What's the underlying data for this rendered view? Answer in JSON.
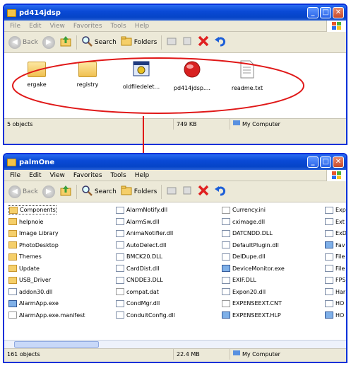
{
  "top_window": {
    "title": "pd414jdsp",
    "menu": [
      "File",
      "Edit",
      "View",
      "Favorites",
      "Tools",
      "Help"
    ],
    "toolbar": {
      "back": "Back",
      "search": "Search",
      "folders": "Folders"
    },
    "icons": [
      {
        "label": "ergake",
        "icon": "folder-icon"
      },
      {
        "label": "registry",
        "icon": "folder-icon"
      },
      {
        "label": "oldfiledelet...",
        "icon": "application-icon"
      },
      {
        "label": "pd414jdsp....",
        "icon": "red-ball-icon"
      },
      {
        "label": "readme.txt",
        "icon": "text-file-icon"
      }
    ],
    "status": {
      "objects": "5 objects",
      "size": "749 KB",
      "location": "My Computer"
    }
  },
  "bottom_window": {
    "title": "palmOne",
    "menu": [
      "File",
      "Edit",
      "View",
      "Favorites",
      "Tools",
      "Help"
    ],
    "toolbar": {
      "back": "Back",
      "search": "Search",
      "folders": "Folders"
    },
    "columns": [
      [
        {
          "name": "Components",
          "type": "folder"
        },
        {
          "name": "helpnoie",
          "type": "folder"
        },
        {
          "name": "Image Library",
          "type": "folder"
        },
        {
          "name": "PhotoDesktop",
          "type": "folder"
        },
        {
          "name": "Themes",
          "type": "folder"
        },
        {
          "name": "Update",
          "type": "folder"
        },
        {
          "name": "USB_Driver",
          "type": "folder"
        },
        {
          "name": "addon30.dll",
          "type": "dll"
        },
        {
          "name": "AlarmApp.exe",
          "type": "exe"
        },
        {
          "name": "AlarmApp.exe.manifest",
          "type": "txt"
        }
      ],
      [
        {
          "name": "AlarmNotify.dll",
          "type": "dll"
        },
        {
          "name": "AlarmSw.dll",
          "type": "dll"
        },
        {
          "name": "AnimaNotifier.dll",
          "type": "dll"
        },
        {
          "name": "AutoDelect.dll",
          "type": "dll"
        },
        {
          "name": "BMCK20.DLL",
          "type": "dll"
        },
        {
          "name": "CardDist.dll",
          "type": "dll"
        },
        {
          "name": "CNDDE3.DLL",
          "type": "dll"
        },
        {
          "name": "compat.dat",
          "type": "txt"
        },
        {
          "name": "CondMgr.dll",
          "type": "dll"
        },
        {
          "name": "ConduitConfig.dll",
          "type": "dll"
        }
      ],
      [
        {
          "name": "Currency.ini",
          "type": "txt"
        },
        {
          "name": "cximage.dll",
          "type": "dll"
        },
        {
          "name": "DATCNDD.DLL",
          "type": "dll"
        },
        {
          "name": "DefaultPlugin.dll",
          "type": "dll"
        },
        {
          "name": "DelDupe.dll",
          "type": "dll"
        },
        {
          "name": "DeviceMonitor.exe",
          "type": "exe"
        },
        {
          "name": "EXIF.DLL",
          "type": "dll"
        },
        {
          "name": "Expon20.dll",
          "type": "dll"
        },
        {
          "name": "EXPENSEEXT.CNT",
          "type": "txt"
        },
        {
          "name": "EXPENSEEXT.HLP",
          "type": "exe"
        }
      ],
      [
        {
          "name": "Exp",
          "type": "dll"
        },
        {
          "name": "Ext",
          "type": "dll"
        },
        {
          "name": "ExD",
          "type": "dll"
        },
        {
          "name": "Fav",
          "type": "exe"
        },
        {
          "name": "File",
          "type": "dll"
        },
        {
          "name": "File",
          "type": "dll"
        },
        {
          "name": "FPS",
          "type": "dll"
        },
        {
          "name": "Har",
          "type": "dll"
        },
        {
          "name": "HO",
          "type": "dll"
        },
        {
          "name": "HO",
          "type": "exe"
        }
      ]
    ],
    "status": {
      "objects": "161 objects",
      "size": "22.4 MB",
      "location": "My Computer"
    }
  }
}
